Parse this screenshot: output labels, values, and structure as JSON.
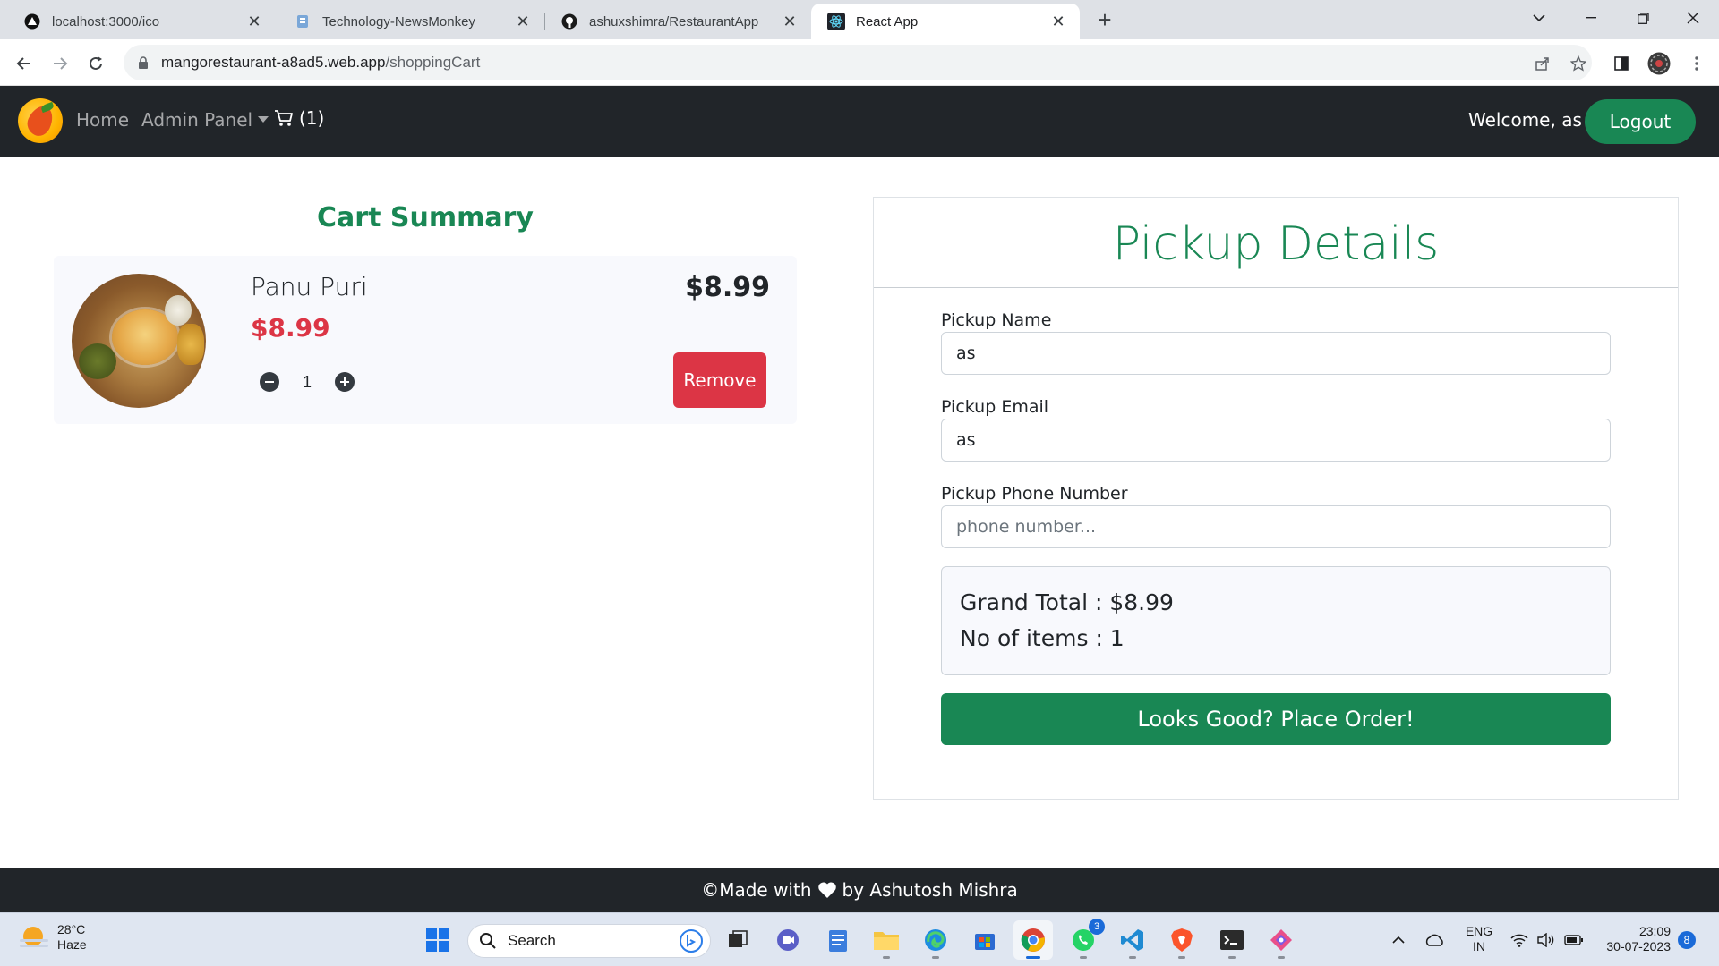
{
  "browser": {
    "tabs": [
      {
        "title": "localhost:3000/ico",
        "icon": "vercel-triangle-icon"
      },
      {
        "title": "Technology-NewsMonkey",
        "icon": "news-monkey-icon"
      },
      {
        "title": "ashuxshimra/RestaurantApp",
        "icon": "github-icon"
      },
      {
        "title": "React App",
        "icon": "react-icon",
        "active": true
      }
    ],
    "url_host": "mangorestaurant-a8ad5.web.app",
    "url_path": "/shoppingCart"
  },
  "navbar": {
    "home_label": "Home",
    "admin_label": "Admin Panel",
    "cart_count": "(1)",
    "welcome_text": "Welcome, as",
    "logout_label": "Logout"
  },
  "cart": {
    "title": "Cart Summary",
    "items": [
      {
        "name": "Panu Puri",
        "price": "$8.99",
        "quantity": "1",
        "total": "$8.99",
        "remove_label": "Remove"
      }
    ]
  },
  "pickup": {
    "title": "Pickup Details",
    "name_label": "Pickup Name",
    "name_value": "as",
    "email_label": "Pickup Email",
    "email_value": "as",
    "phone_label": "Pickup Phone Number",
    "phone_placeholder": "phone number...",
    "grand_total": "Grand Total : $8.99",
    "item_count": "No of items : 1",
    "place_order_label": "Looks Good? Place Order!"
  },
  "footer": {
    "prefix": "©Made with",
    "suffix": "by Ashutosh Mishra"
  },
  "taskbar": {
    "temperature": "28°C",
    "condition": "Haze",
    "search_placeholder": "Search",
    "whatsapp_badge": "3",
    "lang_top": "ENG",
    "lang_bottom": "IN",
    "time": "23:09",
    "date": "30-07-2023",
    "notification_count": "8"
  },
  "colors": {
    "brand_green": "#198754",
    "danger_red": "#dc3545",
    "navbar_dark": "#212529"
  }
}
